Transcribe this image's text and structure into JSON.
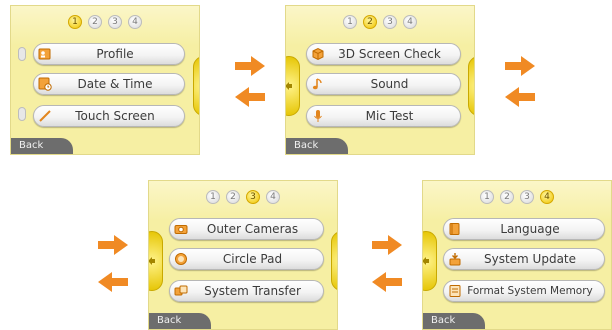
{
  "screens": [
    {
      "active_page": 1,
      "pages": [
        "1",
        "2",
        "3",
        "4"
      ],
      "buttons": [
        {
          "label": "Profile",
          "icon": "profile-card-icon"
        },
        {
          "label": "Date & Time",
          "icon": "clock-icon"
        },
        {
          "label": "Touch Screen",
          "icon": "stylus-icon"
        }
      ],
      "back_label": "Back"
    },
    {
      "active_page": 2,
      "pages": [
        "1",
        "2",
        "3",
        "4"
      ],
      "buttons": [
        {
          "label": "3D Screen Check",
          "icon": "3d-box-icon"
        },
        {
          "label": "Sound",
          "icon": "music-note-icon"
        },
        {
          "label": "Mic Test",
          "icon": "microphone-icon"
        }
      ],
      "back_label": "Back"
    },
    {
      "active_page": 3,
      "pages": [
        "1",
        "2",
        "3",
        "4"
      ],
      "buttons": [
        {
          "label": "Outer Cameras",
          "icon": "camera-icon"
        },
        {
          "label": "Circle Pad",
          "icon": "circle-pad-icon"
        },
        {
          "label": "System Transfer",
          "icon": "transfer-icon"
        }
      ],
      "back_label": "Back"
    },
    {
      "active_page": 4,
      "pages": [
        "1",
        "2",
        "3",
        "4"
      ],
      "buttons": [
        {
          "label": "Language",
          "icon": "book-icon"
        },
        {
          "label": "System Update",
          "icon": "system-update-icon"
        },
        {
          "label": "Format System Memory",
          "icon": "memory-format-icon"
        }
      ],
      "back_label": "Back"
    }
  ],
  "colors": {
    "accent_arrow": "#f08a24",
    "active_page": "#f0c400",
    "screen_bg": "#f6efa3",
    "back_bar": "#6d6d6d"
  }
}
